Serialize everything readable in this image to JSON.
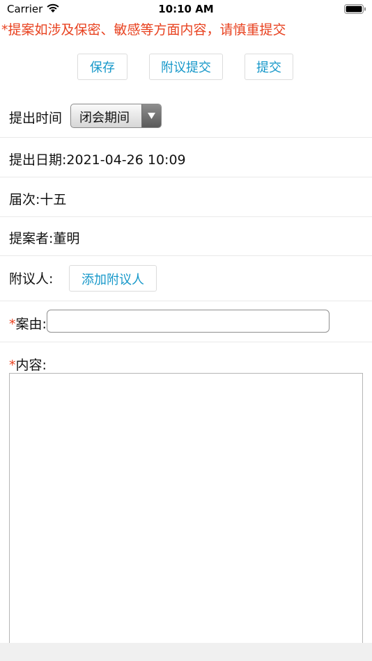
{
  "status_bar": {
    "carrier": "Carrier",
    "time": "10:10 AM"
  },
  "warning": {
    "text": "*提案如涉及保密、敏感等方面内容，请慎重提交",
    "color": "#e8411f"
  },
  "toolbar": {
    "save_label": "保存",
    "cosign_submit_label": "附议提交",
    "submit_label": "提交"
  },
  "form": {
    "time": {
      "label": "提出时间",
      "selected": "闭会期间"
    },
    "date": {
      "text": "提出日期:2021-04-26 10:09"
    },
    "session": {
      "text": "届次:十五"
    },
    "proposer": {
      "text": "提案者:董明"
    },
    "cosigner": {
      "label": "附议人:",
      "add_button": "添加附议人"
    },
    "subject": {
      "required_mark": "*",
      "label": "案由:",
      "value": ""
    },
    "content": {
      "required_mark": "*",
      "label": "内容:",
      "value": ""
    }
  },
  "colors": {
    "accent": "#1597c9",
    "required": "#e8411f"
  }
}
